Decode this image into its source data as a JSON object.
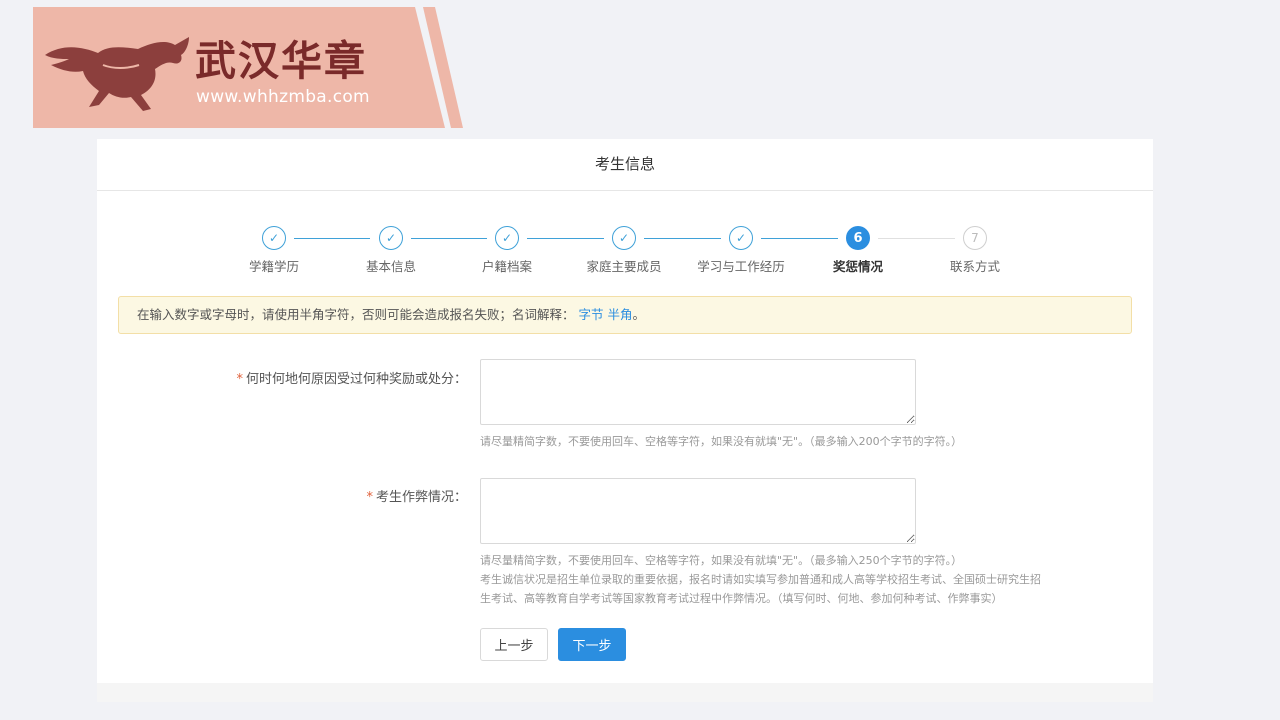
{
  "banner": {
    "brand": "武汉华章",
    "url": "www.whhzmba.com",
    "bg_color": "#eeb7a8",
    "brand_color": "#7a2a2a"
  },
  "card": {
    "title": "考生信息"
  },
  "steps": [
    {
      "label": "学籍学历",
      "state": "done",
      "marker": "✓"
    },
    {
      "label": "基本信息",
      "state": "done",
      "marker": "✓"
    },
    {
      "label": "户籍档案",
      "state": "done",
      "marker": "✓"
    },
    {
      "label": "家庭主要成员",
      "state": "done",
      "marker": "✓"
    },
    {
      "label": "学习与工作经历",
      "state": "done",
      "marker": "✓"
    },
    {
      "label": "奖惩情况",
      "state": "active",
      "marker": "6"
    },
    {
      "label": "联系方式",
      "state": "todo",
      "marker": "7"
    }
  ],
  "notice": {
    "text": "在输入数字或字母时，请使用半角字符，否则可能会造成报名失败；名词解释：",
    "link1": "字节",
    "link2": "半角",
    "end": "。"
  },
  "form": {
    "field1": {
      "required_mark": "*",
      "label": "何时何地何原因受过何种奖励或处分：",
      "value": "",
      "help": "请尽量精简字数，不要使用回车、空格等字符，如果没有就填\"无\"。（最多输入200个字节的字符。）"
    },
    "field2": {
      "required_mark": "*",
      "label": "考生作弊情况：",
      "value": "",
      "help1": "请尽量精简字数，不要使用回车、空格等字符，如果没有就填\"无\"。（最多输入250个字节的字符。）",
      "help2": "考生诚信状况是招生单位录取的重要依据，报名时请如实填写参加普通和成人高等学校招生考试、全国硕士研究生招",
      "help3": "生考试、高等教育自学考试等国家教育考试过程中作弊情况。（填写何时、何地、参加何种考试、作弊事实）"
    }
  },
  "buttons": {
    "prev": "上一步",
    "next": "下一步"
  },
  "colors": {
    "primary": "#2b8ee0",
    "step_done": "#3fa1d8",
    "notice_bg": "#fcf8e3",
    "required": "#e0603a"
  }
}
